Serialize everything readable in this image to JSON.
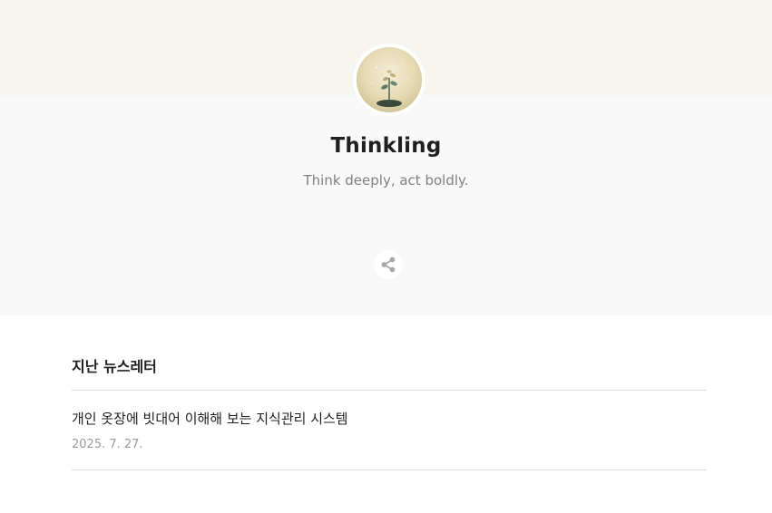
{
  "profile": {
    "name": "Thinkling",
    "tagline": "Think deeply, act boldly.",
    "avatar_icon": "sprout-icon"
  },
  "share": {
    "icon": "share-icon"
  },
  "newsletters": {
    "heading": "지난 뉴스레터",
    "items": [
      {
        "title": "개인 옷장에 빗대어 이해해 보는 지식관리 시스템",
        "date": "2025. 7. 27."
      }
    ]
  },
  "colors": {
    "banner": "#f7f5ef",
    "hero": "#f9f9f9",
    "text": "#1f1f1f",
    "muted": "#808080"
  }
}
